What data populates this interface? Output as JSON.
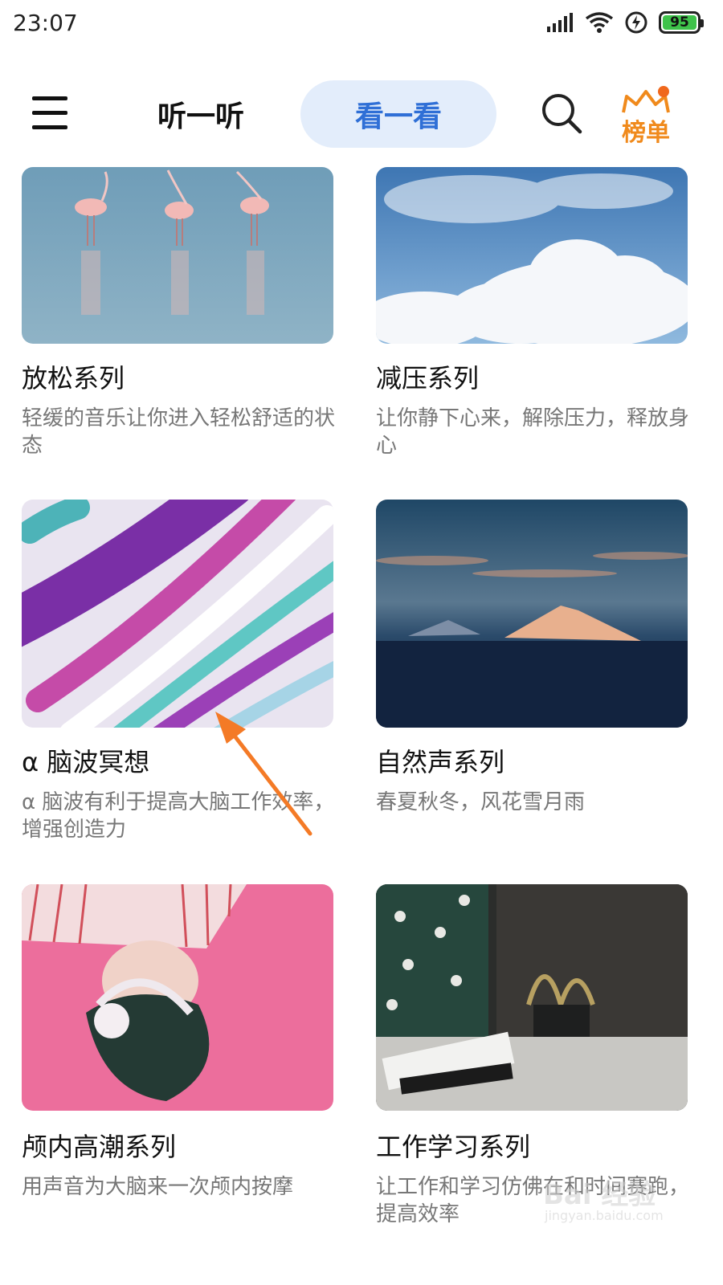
{
  "status_bar": {
    "time": "23:07",
    "battery": "95",
    "icons": [
      "signal-icon",
      "wifi-icon",
      "charging-icon",
      "battery-icon"
    ]
  },
  "header": {
    "menu_icon": "menu-icon",
    "tabs": [
      {
        "label": "听一听",
        "active": false
      },
      {
        "label": "看一看",
        "active": true
      }
    ],
    "search_icon": "search-icon",
    "rank_label": "榜单"
  },
  "cards": [
    {
      "title": "放松系列",
      "desc": "轻缓的音乐让你进入轻松舒适的状态",
      "image": "flamingos-lake"
    },
    {
      "title": "减压系列",
      "desc": "让你静下心来，解除压力，释放身心",
      "image": "sky-clouds"
    },
    {
      "title": "α 脑波冥想",
      "desc": "α 脑波有利于提高大脑工作效率，增强创造力",
      "image": "fluid-art-purple"
    },
    {
      "title": "自然声系列",
      "desc": "春夏秋冬，风花雪月雨",
      "image": "mountain-dusk"
    },
    {
      "title": "颅内高潮系列",
      "desc": "用声音为大脑来一次颅内按摩",
      "image": "girl-headphones-pink"
    },
    {
      "title": "工作学习系列",
      "desc": "让工作和学习仿佛在和时间赛跑，提高效率",
      "image": "cozy-books-plant"
    }
  ],
  "watermark": {
    "text": "Bai 经验",
    "url": "jingyan.baidu.com"
  },
  "colors": {
    "accent": "#2f6fd6",
    "tab_active_bg": "#e3edfb",
    "rank": "#f08a1c",
    "annotation_arrow": "#f47a26"
  }
}
